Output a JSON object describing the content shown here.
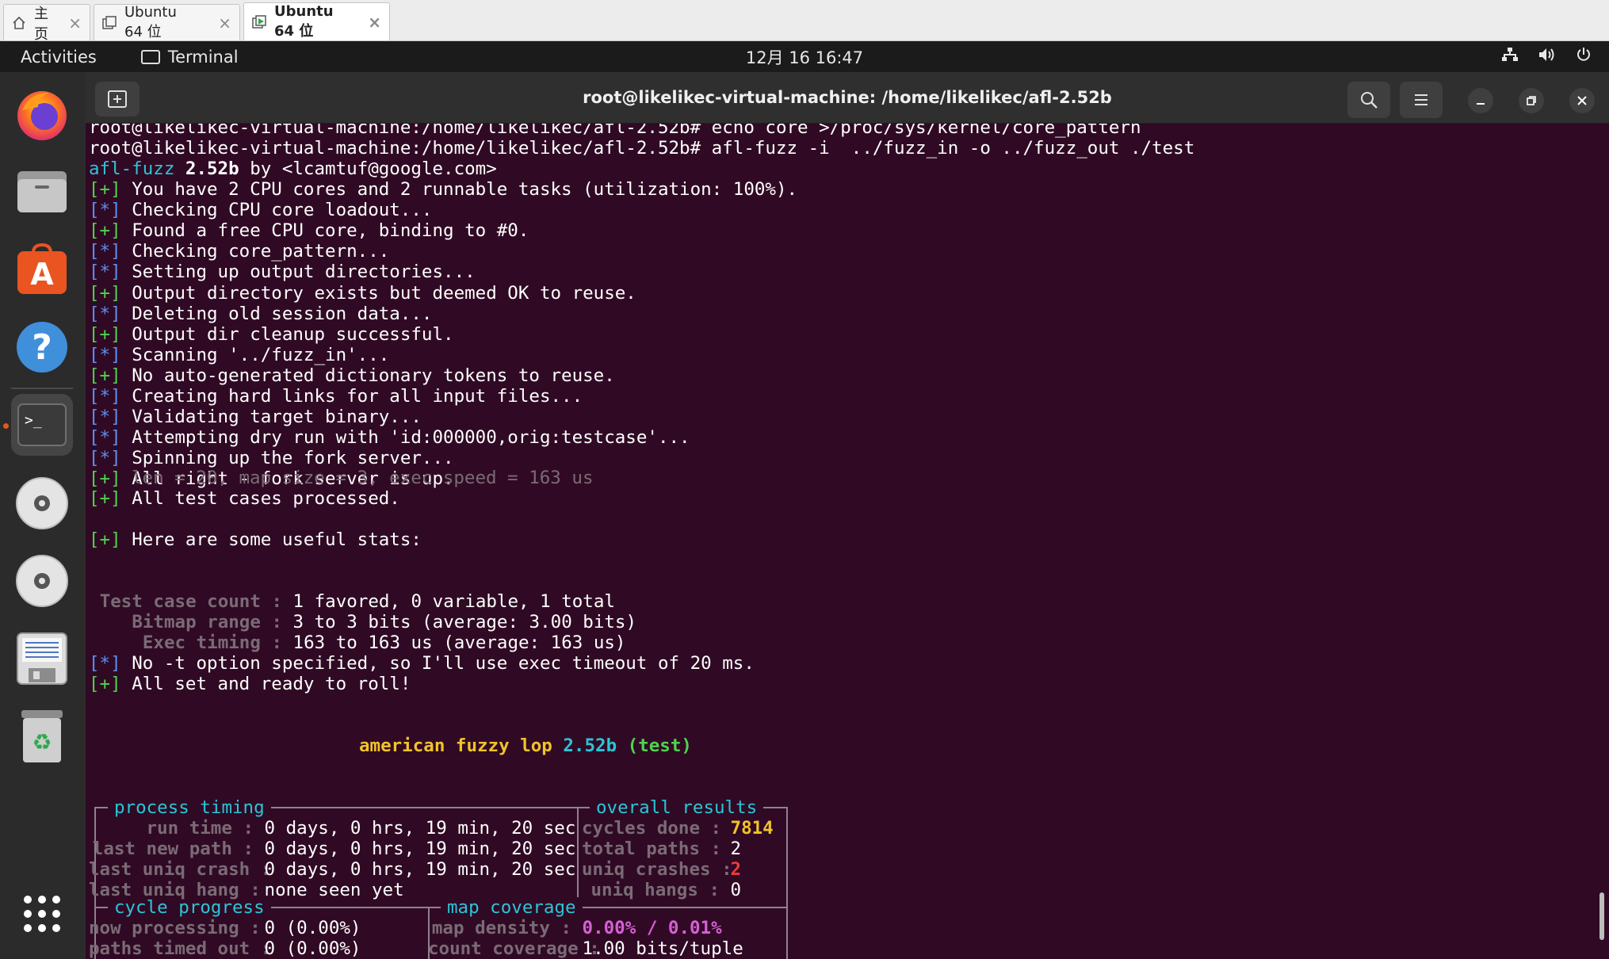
{
  "host_tabs": [
    {
      "label": "主页"
    },
    {
      "label": "Ubuntu 64 位"
    },
    {
      "label": "Ubuntu 64 位"
    }
  ],
  "topbar": {
    "activities": "Activities",
    "app": "Terminal",
    "clock": "12月 16  16:47"
  },
  "window": {
    "title": "root@likelikec-virtual-machine: /home/likelikec/afl-2.52b"
  },
  "terminal": {
    "cut_line": "root@likelikec-virtual-machine:/home/likelikec/afl-2.52b# echo core >/proc/sys/kernel/core_pattern",
    "cmd_line": "root@likelikec-virtual-machine:/home/likelikec/afl-2.52b# afl-fuzz -i  ../fuzz_in -o ../fuzz_out ./test",
    "banner_name": "afl-fuzz",
    "banner_ver": "2.52b",
    "banner_by": "by <lcamtuf@google.com>",
    "plus": "[+]",
    "star": "[*]",
    "messages": [
      {
        "tag": "+",
        "text": "You have 2 CPU cores and 2 runnable tasks (utilization: 100%)."
      },
      {
        "tag": "*",
        "text": "Checking CPU core loadout..."
      },
      {
        "tag": "+",
        "text": "Found a free CPU core, binding to #0."
      },
      {
        "tag": "*",
        "text": "Checking core_pattern..."
      },
      {
        "tag": "*",
        "text": "Setting up output directories..."
      },
      {
        "tag": "+",
        "text": "Output directory exists but deemed OK to reuse."
      },
      {
        "tag": "*",
        "text": "Deleting old session data..."
      },
      {
        "tag": "+",
        "text": "Output dir cleanup successful."
      },
      {
        "tag": "*",
        "text": "Scanning '../fuzz_in'..."
      },
      {
        "tag": "+",
        "text": "No auto-generated dictionary tokens to reuse."
      },
      {
        "tag": "*",
        "text": "Creating hard links for all input files..."
      },
      {
        "tag": "*",
        "text": "Validating target binary..."
      },
      {
        "tag": "*",
        "text": "Attempting dry run with 'id:000000,orig:testcase'..."
      },
      {
        "tag": "*",
        "text": "Spinning up the fork server..."
      },
      {
        "tag": "+",
        "text": "All right - fork server is up."
      }
    ],
    "dry_run_stats": "len = 20, map size = 3, exec speed = 163 us",
    "processed": "All test cases processed.",
    "useful": "Here are some useful stats:",
    "stats": [
      {
        "label": "Test case count :",
        "value": "1 favored, 0 variable, 1 total"
      },
      {
        "label": "Bitmap range :",
        "value": "3 to 3 bits (average: 3.00 bits)"
      },
      {
        "label": "Exec timing :",
        "value": "163 to 163 us (average: 163 us)"
      }
    ],
    "timeout_msg": "No -t option specified, so I'll use exec timeout of 20 ms.",
    "ready_msg": "All set and ready to roll!",
    "afl_title_a": "american fuzzy lop",
    "afl_title_ver": "2.52b",
    "afl_title_target": "(test)",
    "process_timing": {
      "header": "process timing",
      "rows": [
        {
          "label": "run time :",
          "value": "0 days, 0 hrs, 19 min, 20 sec"
        },
        {
          "label": "last new path :",
          "value": "0 days, 0 hrs, 19 min, 20 sec"
        },
        {
          "label": "last uniq crash :",
          "value": "0 days, 0 hrs, 19 min, 20 sec"
        },
        {
          "label": "last uniq hang :",
          "value": "none seen yet"
        }
      ]
    },
    "overall_results": {
      "header": "overall results",
      "rows": [
        {
          "label": "cycles done :",
          "value": "7814"
        },
        {
          "label": "total paths :",
          "value": "2"
        },
        {
          "label": "uniq crashes :",
          "value": "2"
        },
        {
          "label": "uniq hangs :",
          "value": "0"
        }
      ]
    },
    "cycle_progress": {
      "header": "cycle progress",
      "rows": [
        {
          "label": "now processing :",
          "value": "0 (0.00%)"
        },
        {
          "label": "paths timed out :",
          "value": "0 (0.00%)"
        }
      ]
    },
    "map_coverage": {
      "header": "map coverage",
      "rows": [
        {
          "label": "map density :",
          "value": "0.00% / 0.01%"
        },
        {
          "label": "count coverage :",
          "value": "1.00 bits/tuple"
        }
      ]
    }
  },
  "icons": {
    "home": "home-icon",
    "vm": "vm-icon",
    "vm_running": "vm-running-icon",
    "network": "network-icon",
    "volume": "volume-icon",
    "power": "power-icon"
  }
}
